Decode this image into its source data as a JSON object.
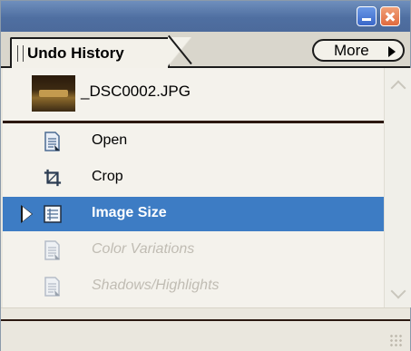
{
  "panel": {
    "tab_label": "Undo History",
    "more_label": "More"
  },
  "snapshot": {
    "label": "_DSC0002.JPG",
    "thumb_icon": "image-thumbnail"
  },
  "history": [
    {
      "label": "Open",
      "icon": "document-icon",
      "state": "normal"
    },
    {
      "label": "Crop",
      "icon": "crop-icon",
      "state": "normal"
    },
    {
      "label": "Image Size",
      "icon": "image-size-icon",
      "state": "selected"
    },
    {
      "label": "Color Variations",
      "icon": "document-icon",
      "state": "inactive"
    },
    {
      "label": "Shadows/Highlights",
      "icon": "document-icon",
      "state": "inactive"
    }
  ],
  "colors": {
    "titlebar": "#4f6fa1",
    "selection": "#3d7cc4",
    "panel_bg": "#eae7de"
  }
}
